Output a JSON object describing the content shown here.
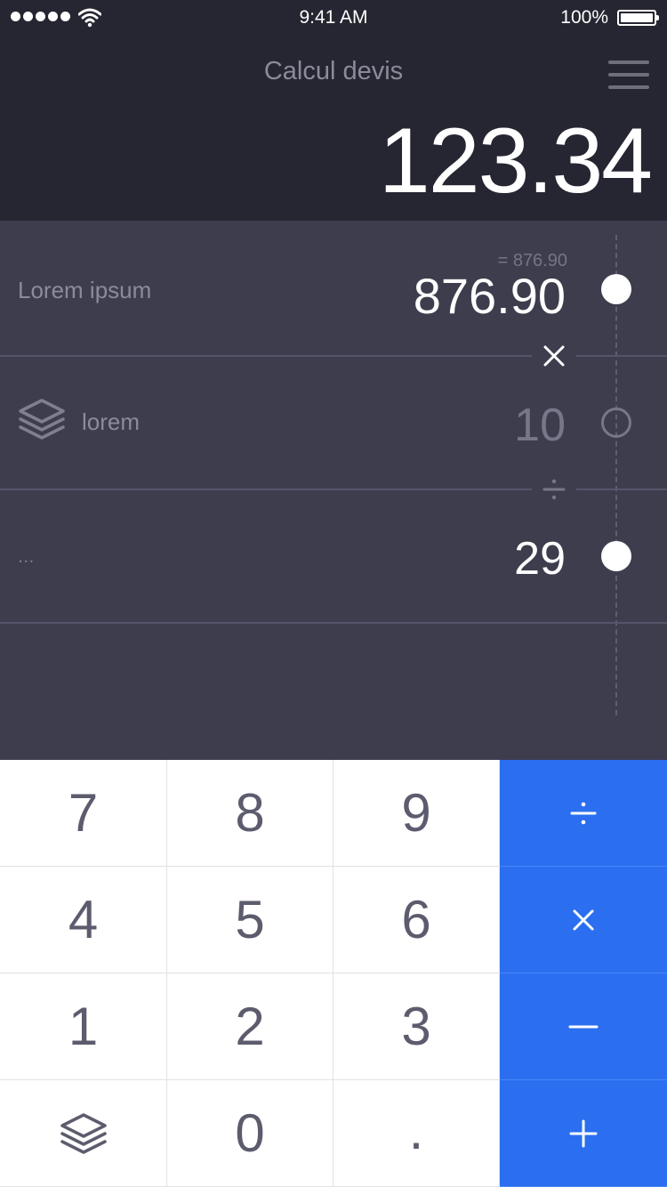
{
  "status_bar": {
    "time": "9:41 AM",
    "battery": "100%",
    "signal_icon": "signal-dots-icon",
    "wifi_icon": "wifi-icon",
    "battery_icon": "battery-icon"
  },
  "header": {
    "title": "Calcul devis",
    "menu_icon": "hamburger-menu-icon",
    "result": "123.34"
  },
  "rows": [
    {
      "label": "Lorem ipsum",
      "value": "876.90",
      "sub_result": "= 876.90",
      "active": true,
      "value_color": "#ffffff"
    },
    {
      "label": "lorem",
      "icon": "layers-icon",
      "value": "10",
      "active": false,
      "value_color": "#77778a"
    },
    {
      "label": "...",
      "value": "29",
      "active": true,
      "value_color": "#ffffff"
    }
  ],
  "operators": [
    {
      "symbol": "×",
      "color": "#ffffff"
    },
    {
      "symbol": "÷",
      "color": "#77778a"
    }
  ],
  "keypad": {
    "keys": [
      [
        "7",
        "8",
        "9",
        "÷"
      ],
      [
        "4",
        "5",
        "6",
        "×"
      ],
      [
        "1",
        "2",
        "3",
        "−"
      ],
      [
        "",
        "0",
        ".",
        "+"
      ]
    ],
    "layers_key_icon": "layers-icon",
    "operator_color": "#2b6ff0"
  },
  "colors": {
    "header_bg": "#262632",
    "panel_bg": "#3d3d4d",
    "accent": "#2b6ff0"
  }
}
